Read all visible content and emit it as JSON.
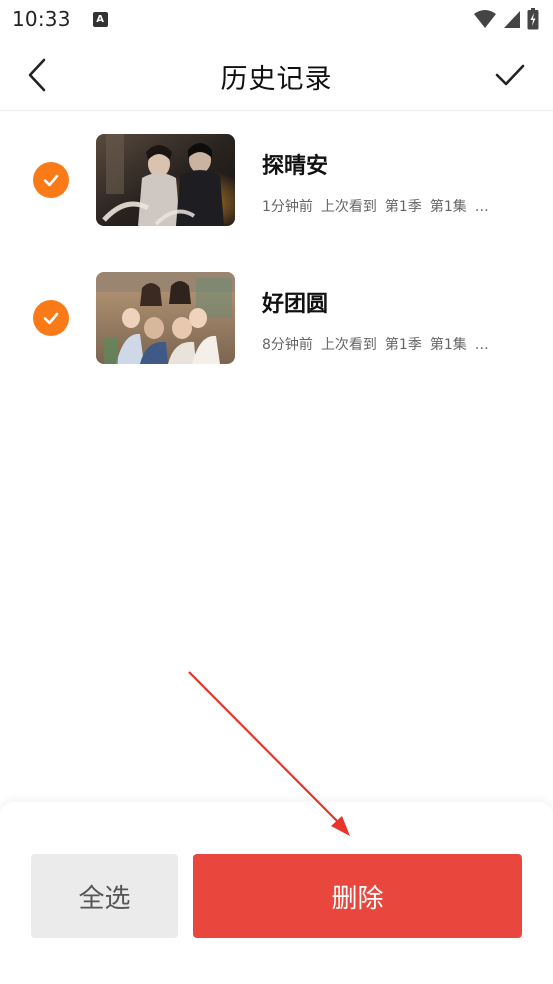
{
  "status_bar": {
    "time": "10:33",
    "notification_icon": "A"
  },
  "header": {
    "title": "历史记录",
    "back_icon": "chevron-left",
    "done_icon": "checkmark"
  },
  "history": [
    {
      "title": "探晴安",
      "meta": [
        "1分钟前",
        "上次看到",
        "第1季",
        "第1集",
        "…"
      ],
      "selected": true
    },
    {
      "title": "好团圆",
      "meta": [
        "8分钟前",
        "上次看到",
        "第1季",
        "第1集",
        "…"
      ],
      "selected": true
    }
  ],
  "bottom_bar": {
    "select_all_label": "全选",
    "delete_label": "删除"
  },
  "colors": {
    "accent_check": "#fa7a18",
    "delete_button": "#e9473d",
    "select_all_bg": "#ebebeb",
    "annotation_arrow": "#e8342b"
  }
}
